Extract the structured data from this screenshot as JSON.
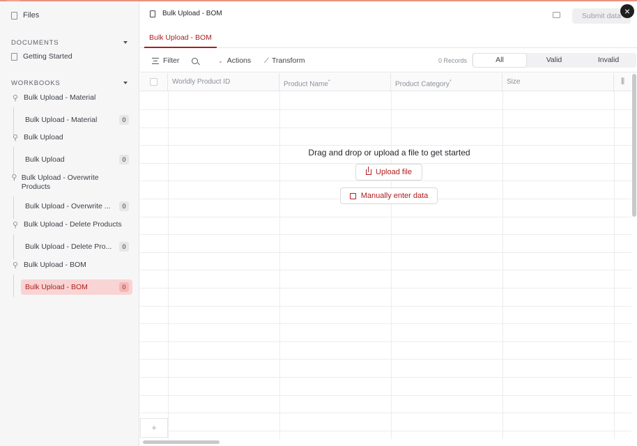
{
  "sidebar": {
    "files_label": "Files",
    "documents_header": "DOCUMENTS",
    "documents": [
      {
        "label": "Getting Started"
      }
    ],
    "workbooks_header": "WORKBOOKS",
    "workbooks": [
      {
        "label": "Bulk Upload - Material",
        "sheet": "Bulk Upload - Material",
        "count": "0"
      },
      {
        "label": "Bulk Upload",
        "sheet": "Bulk Upload",
        "count": "0"
      },
      {
        "label": "Bulk Upload - Overwrite Products",
        "sheet": "Bulk Upload - Overwrite ...",
        "count": "0"
      },
      {
        "label": "Bulk Upload - Delete Products",
        "sheet": "Bulk Upload - Delete Pro...",
        "count": "0"
      },
      {
        "label": "Bulk Upload - BOM",
        "sheet": "Bulk Upload - BOM",
        "count": "0"
      }
    ]
  },
  "header": {
    "title": "Bulk Upload - BOM",
    "submit_label": "Submit data",
    "close": "×"
  },
  "tabs": [
    {
      "label": "Bulk Upload - BOM"
    }
  ],
  "toolbar": {
    "filter": "Filter",
    "actions": "Actions",
    "transform": "Transform",
    "records": "0 Records",
    "segments": [
      "All",
      "Valid",
      "Invalid"
    ]
  },
  "grid": {
    "columns": [
      {
        "label": "Worldly Product ID",
        "required": false
      },
      {
        "label": "Product Name",
        "required": true
      },
      {
        "label": "Product Category",
        "required": true
      },
      {
        "label": "Size",
        "required": false
      }
    ],
    "add_row": "+"
  },
  "empty_state": {
    "message": "Drag and drop or upload a file to get started",
    "upload_label": "Upload file",
    "manual_label": "Manually enter data"
  },
  "colors": {
    "accent": "#b01c1c",
    "active_bg": "#f9d4d4"
  }
}
